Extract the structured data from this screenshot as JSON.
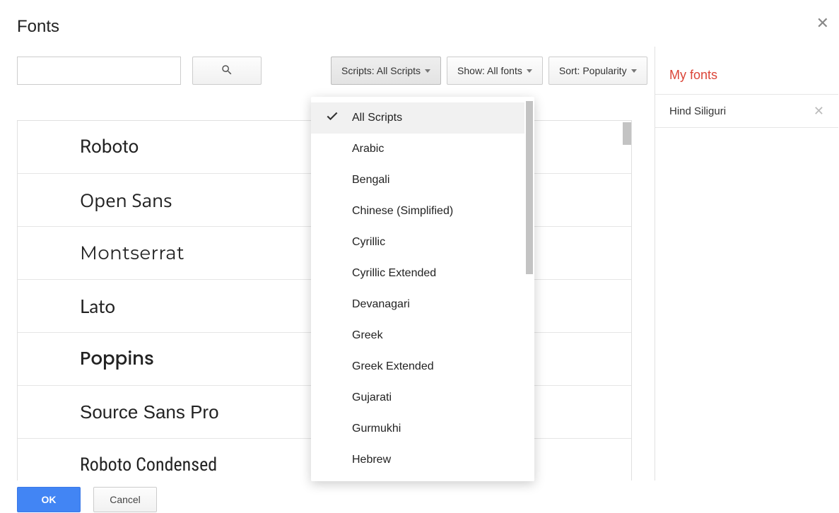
{
  "dialog": {
    "title": "Fonts"
  },
  "filters": {
    "scripts": {
      "label": "Scripts: All Scripts"
    },
    "show": {
      "label": "Show: All fonts"
    },
    "sort": {
      "label": "Sort: Popularity"
    }
  },
  "scripts_dropdown": {
    "selected": "All Scripts",
    "items": [
      "All Scripts",
      "Arabic",
      "Bengali",
      "Chinese (Simplified)",
      "Cyrillic",
      "Cyrillic Extended",
      "Devanagari",
      "Greek",
      "Greek Extended",
      "Gujarati",
      "Gurmukhi",
      "Hebrew"
    ]
  },
  "font_list": [
    "Roboto",
    "Open Sans",
    "Montserrat",
    "Lato",
    "Poppins",
    "Source Sans Pro",
    "Roboto Condensed"
  ],
  "sidebar": {
    "title": "My fonts",
    "items": [
      "Hind Siliguri"
    ]
  },
  "footer": {
    "ok": "OK",
    "cancel": "Cancel"
  }
}
